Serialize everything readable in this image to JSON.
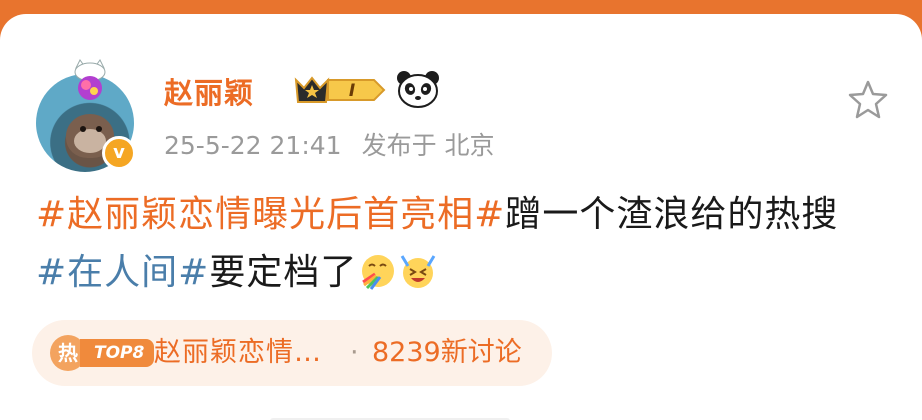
{
  "post": {
    "author": "赵丽颖",
    "level_badge": "I",
    "timestamp": "25-5-22 21:41",
    "source": "发布于 北京",
    "verified_mark": "v",
    "body": {
      "hashtag1": "#赵丽颖恋情曝光后首亮相#",
      "text1": "蹭一个渣浪给的热搜",
      "hashtag2": "#在人间#",
      "text2": "要定档了"
    },
    "emojis": [
      "rainbow-vomit-emoji",
      "cheering-emoji"
    ]
  },
  "topic_chip": {
    "hot_label": "热",
    "rank_label": "TOP8",
    "title": "赵丽颖恋情…",
    "separator": "·",
    "discussion_count": "8239新讨论"
  },
  "colors": {
    "accent_orange": "#ec6c25",
    "hashtag_blue": "#4a7eaa",
    "meta_gray": "#9a9a9a",
    "chip_bg": "#fdf1e8"
  },
  "icons": {
    "follow": "star-outline-icon",
    "crown": "crown-level-icon",
    "panda": "panda-icon"
  }
}
